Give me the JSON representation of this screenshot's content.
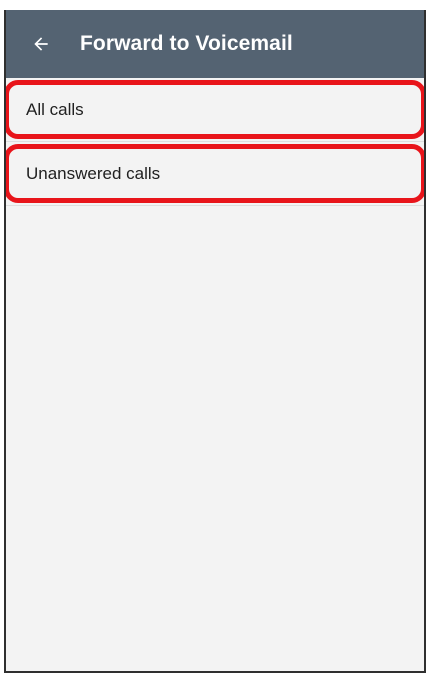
{
  "header": {
    "back_icon": "arrow-left-icon",
    "title": "Forward to Voicemail"
  },
  "options": [
    {
      "label": "All calls",
      "highlighted": true
    },
    {
      "label": "Unanswered calls",
      "highlighted": true
    }
  ],
  "colors": {
    "app_bar": "#546372",
    "background": "#f3f3f3",
    "highlight": "#e8141a",
    "text": "#212121"
  }
}
